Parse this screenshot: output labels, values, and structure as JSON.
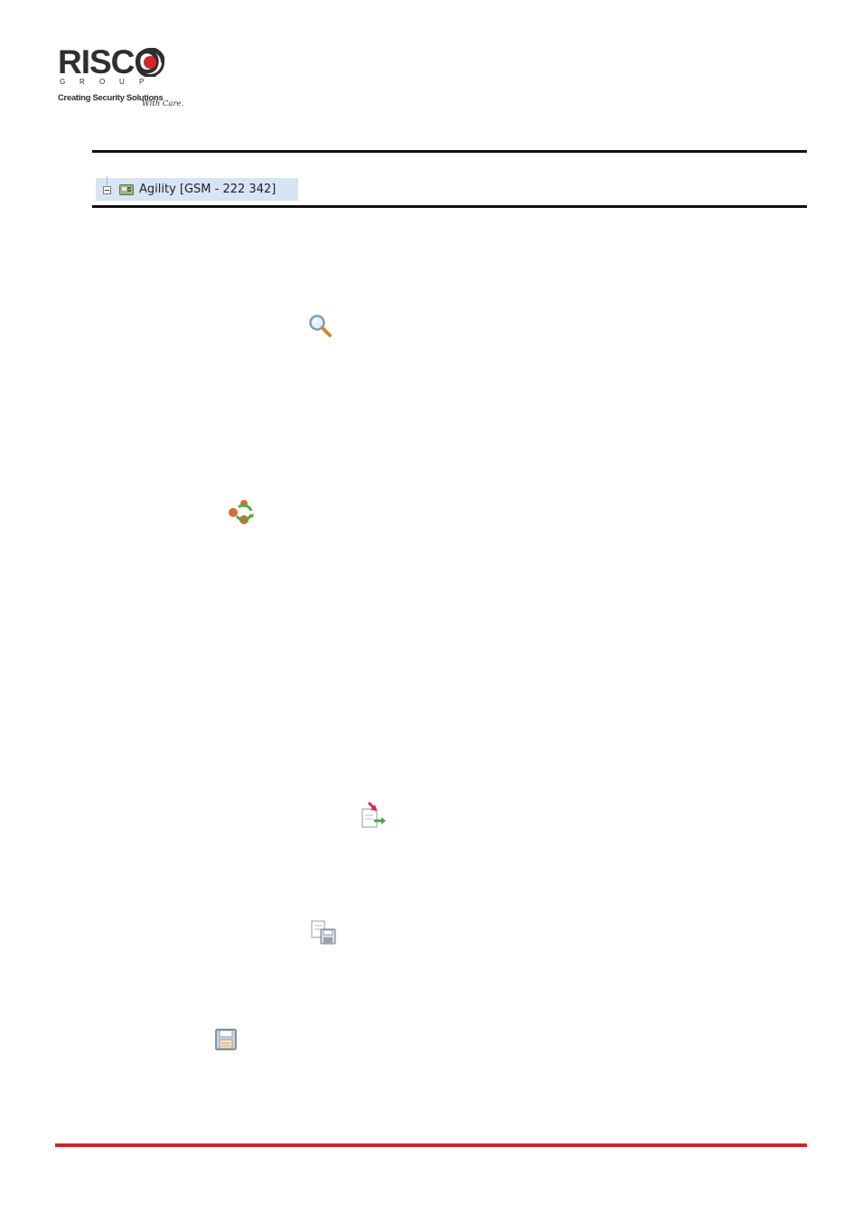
{
  "logo": {
    "brand": "RISCO",
    "group_letters": [
      "G",
      "R",
      "O",
      "U",
      "P"
    ],
    "tagline": "Creating Security Solutions",
    "tagline_script": "With Care."
  },
  "tree": {
    "node_label": "Agility [GSM - 222 342]"
  },
  "colors": {
    "accent_red": "#c8272d",
    "rule": "#111111",
    "selection_bg": "#d6e4f3"
  },
  "icons": {
    "magnifier": "magnifier-icon",
    "sync": "sync-icon",
    "transfer": "transfer-icon",
    "save_copy": "save-copy-icon",
    "floppy": "floppy-icon"
  }
}
